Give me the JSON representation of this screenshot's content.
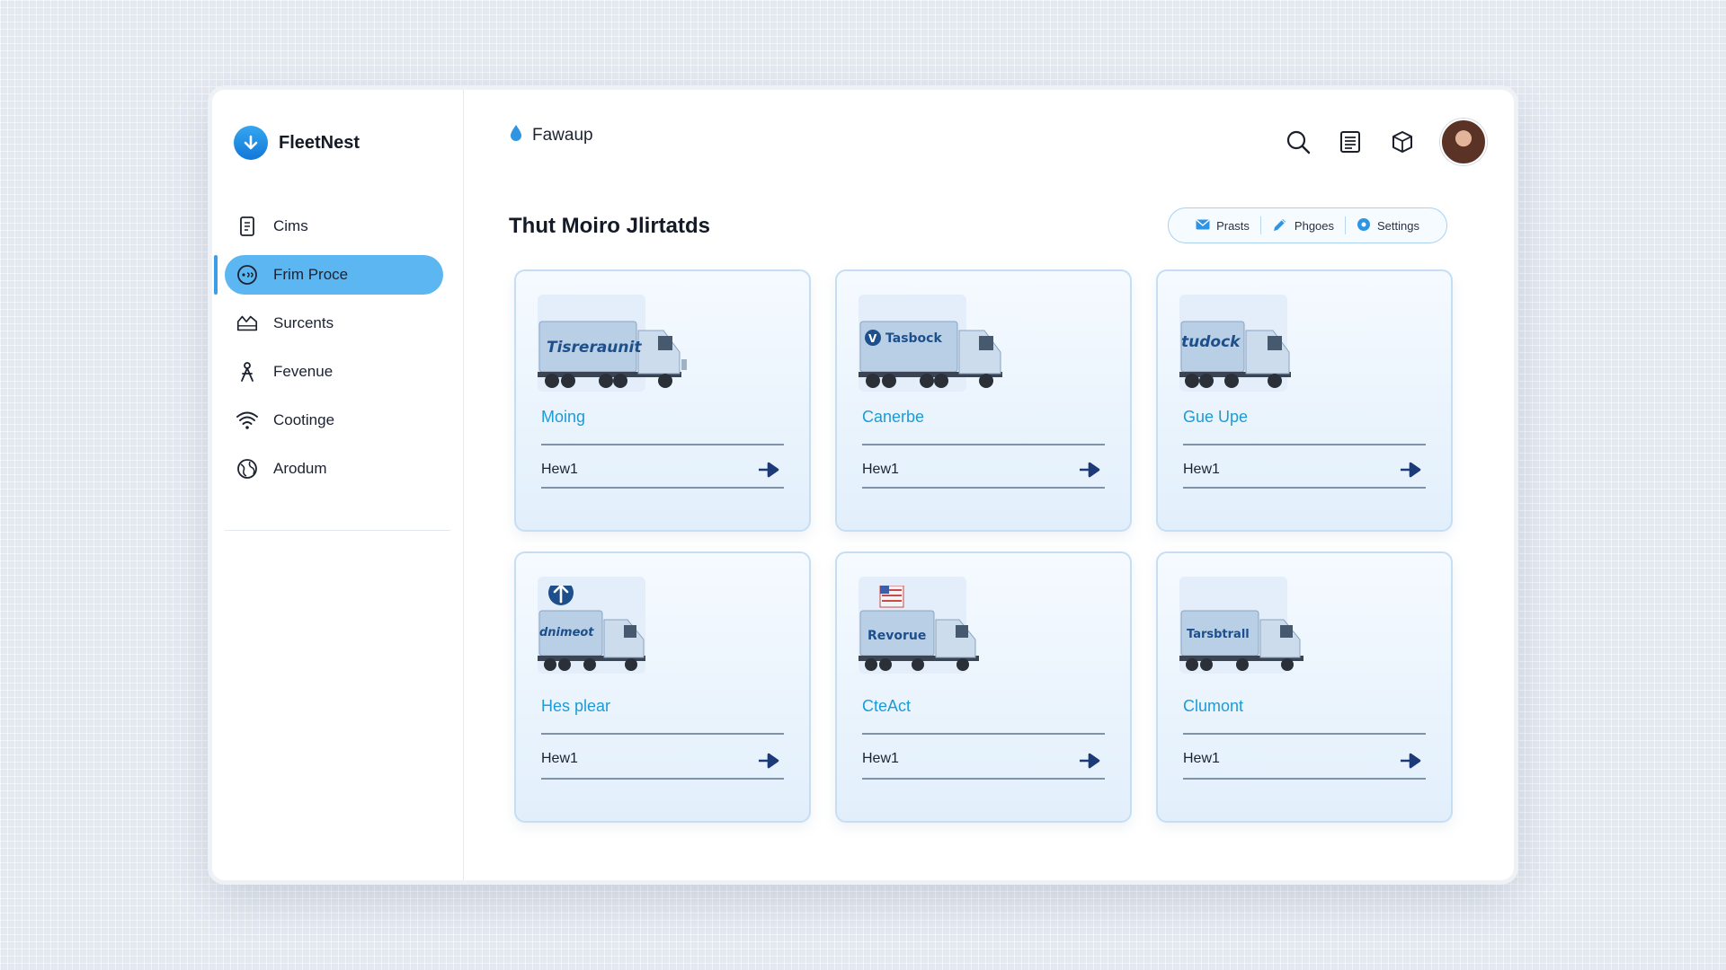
{
  "app": {
    "name": "FleetNest"
  },
  "sidebar": {
    "items": [
      {
        "label": "Cims",
        "icon": "document-icon",
        "active": false
      },
      {
        "label": "Frim Proce",
        "icon": "chat-icon",
        "active": true
      },
      {
        "label": "Surcents",
        "icon": "crown-icon",
        "active": false
      },
      {
        "label": "Fevenue",
        "icon": "person-icon",
        "active": false
      },
      {
        "label": "Cootinge",
        "icon": "wifi-icon",
        "active": false
      },
      {
        "label": "Arodum",
        "icon": "globe-icon",
        "active": false
      }
    ]
  },
  "header": {
    "title": "Fawaup",
    "title_icon": "droplet-icon",
    "icons": [
      "search-icon",
      "list-icon",
      "box-icon",
      "avatar"
    ]
  },
  "main": {
    "page_title": "Thut Moiro Jlirtatds",
    "segments": [
      {
        "label": "Prasts",
        "icon": "mail-icon"
      },
      {
        "label": "Phgoes",
        "icon": "pencil-icon"
      },
      {
        "label": "Settings",
        "icon": "gear-icon"
      }
    ],
    "cards": [
      {
        "title": "Moing",
        "footer": "Hew1",
        "truck_label": "Tisreraunit",
        "badge": "none"
      },
      {
        "title": "Canerbe",
        "footer": "Hew1",
        "truck_label": "Tasbock",
        "badge": "v-logo"
      },
      {
        "title": "Gue Upe",
        "footer": "Hew1",
        "truck_label": "tudock",
        "badge": "none"
      },
      {
        "title": "Hes plear",
        "footer": "Hew1",
        "truck_label": "dnimeot",
        "badge": "up-arrow"
      },
      {
        "title": "CteAct",
        "footer": "Hew1",
        "truck_label": "Revorue",
        "badge": "flag"
      },
      {
        "title": "Clumont",
        "footer": "Hew1",
        "truck_label": "Tarsbtrall",
        "badge": "none"
      }
    ]
  },
  "colors": {
    "accent": "#5cb6f2",
    "brand_blue": "#1e88e5",
    "card_title": "#1e9ad6",
    "arrow": "#1d3a78"
  }
}
